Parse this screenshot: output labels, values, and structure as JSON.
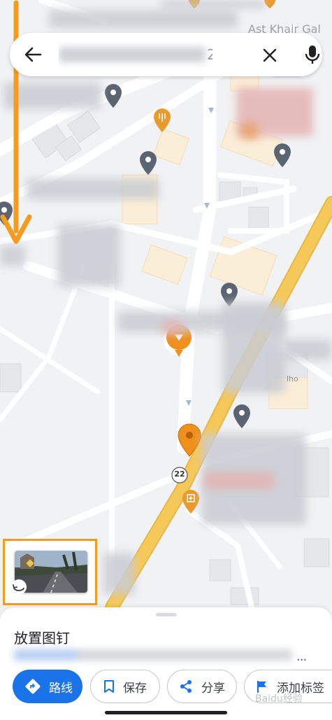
{
  "search": {
    "query_suffix": "2",
    "back_icon": "arrow-left-icon",
    "clear_icon": "close-icon",
    "mic_icon": "microphone-icon"
  },
  "map": {
    "ticker_text": "Ast Khair Gal",
    "road_shield": "22",
    "building_label": "lho"
  },
  "street_view": {
    "thumbnail": "street-view-thumbnail"
  },
  "sheet": {
    "title": "放置图钉",
    "more": "...",
    "buttons": {
      "route": "路线",
      "save": "保存",
      "share": "分享",
      "label": "添加标签"
    }
  },
  "watermark": "Baidu经验",
  "colors": {
    "accent": "#1a73e8",
    "highlight": "#f39c1f",
    "road": "#f5c85a",
    "pin": "#ef8f1c"
  }
}
